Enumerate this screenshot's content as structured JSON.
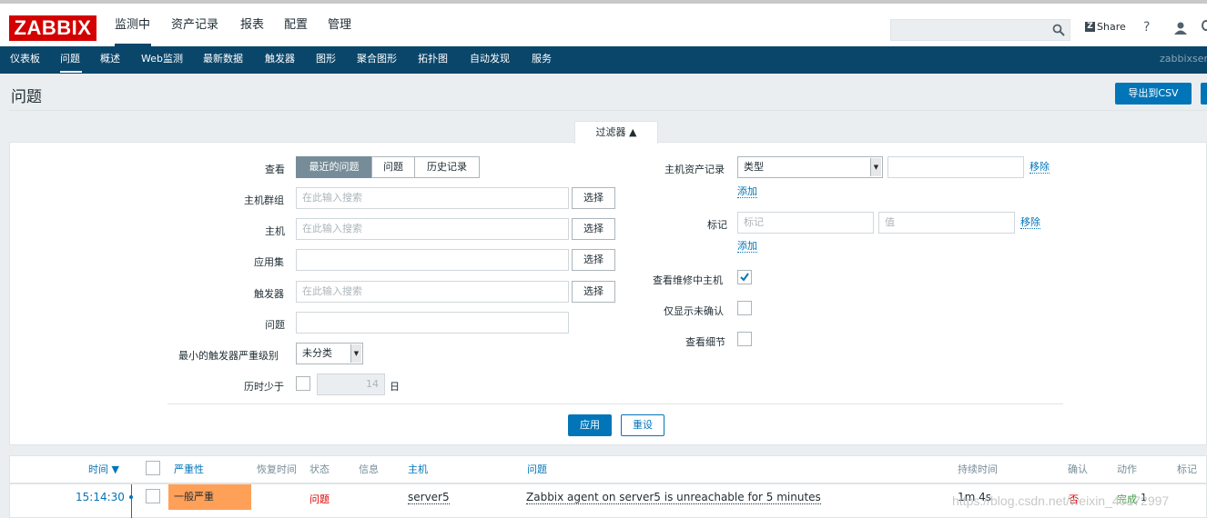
{
  "logo": "ZABBIX",
  "top_menu": [
    "监测中",
    "资产记录",
    "报表",
    "配置",
    "管理"
  ],
  "header_tools": {
    "share": "Share",
    "help": "?"
  },
  "sub_menu": [
    "仪表板",
    "问题",
    "概述",
    "Web监测",
    "最新数据",
    "触发器",
    "图形",
    "聚合图形",
    "拓扑图",
    "自动发现",
    "服务"
  ],
  "server_name": "zabbixserver",
  "page": {
    "title": "问题",
    "export_label": "导出到CSV"
  },
  "filter": {
    "tab_label": "过滤器 ▲",
    "show_label": "查看",
    "show_options": [
      "最近的问题",
      "问题",
      "历史记录"
    ],
    "host_groups_label": "主机群组",
    "hosts_label": "主机",
    "application_label": "应用集",
    "triggers_label": "触发器",
    "problem_label": "问题",
    "min_severity_label": "最小的触发器严重级别",
    "min_severity_value": "未分类",
    "age_label": "历时少于",
    "age_value": "14",
    "age_unit": "日",
    "search_placeholder": "在此输入搜索",
    "select_label": "选择",
    "inventory_label": "主机资产记录",
    "inventory_field": "类型",
    "remove_label": "移除",
    "add_label": "添加",
    "tags_label": "标记",
    "tag_placeholder": "标记",
    "value_placeholder": "值",
    "maintenance_label": "查看维修中主机",
    "unack_label": "仅显示未确认",
    "details_label": "查看细节",
    "apply_label": "应用",
    "reset_label": "重设"
  },
  "table": {
    "headers": {
      "time": "时间 ▼",
      "severity": "严重性",
      "recovery_time": "恢复时间",
      "status": "状态",
      "info": "信息",
      "host": "主机",
      "problem": "问题",
      "duration": "持续时间",
      "ack": "确认",
      "actions": "动作",
      "tags": "标记"
    },
    "rows": [
      {
        "time": "15:14:30",
        "severity": "一般严重",
        "status": "问题",
        "host": "server5",
        "problem": "Zabbix agent on server5 is unreachable for 5 minutes",
        "duration": "1m 4s",
        "ack": "否",
        "actions": "完成",
        "actions_count": "1"
      }
    ]
  },
  "watermark": "https://blog.csdn.net/weixin_40172997",
  "colors": {
    "brand": "#d40000",
    "nav": "#0a466a",
    "accent": "#0275b8",
    "severity_average": "#ffa059"
  }
}
